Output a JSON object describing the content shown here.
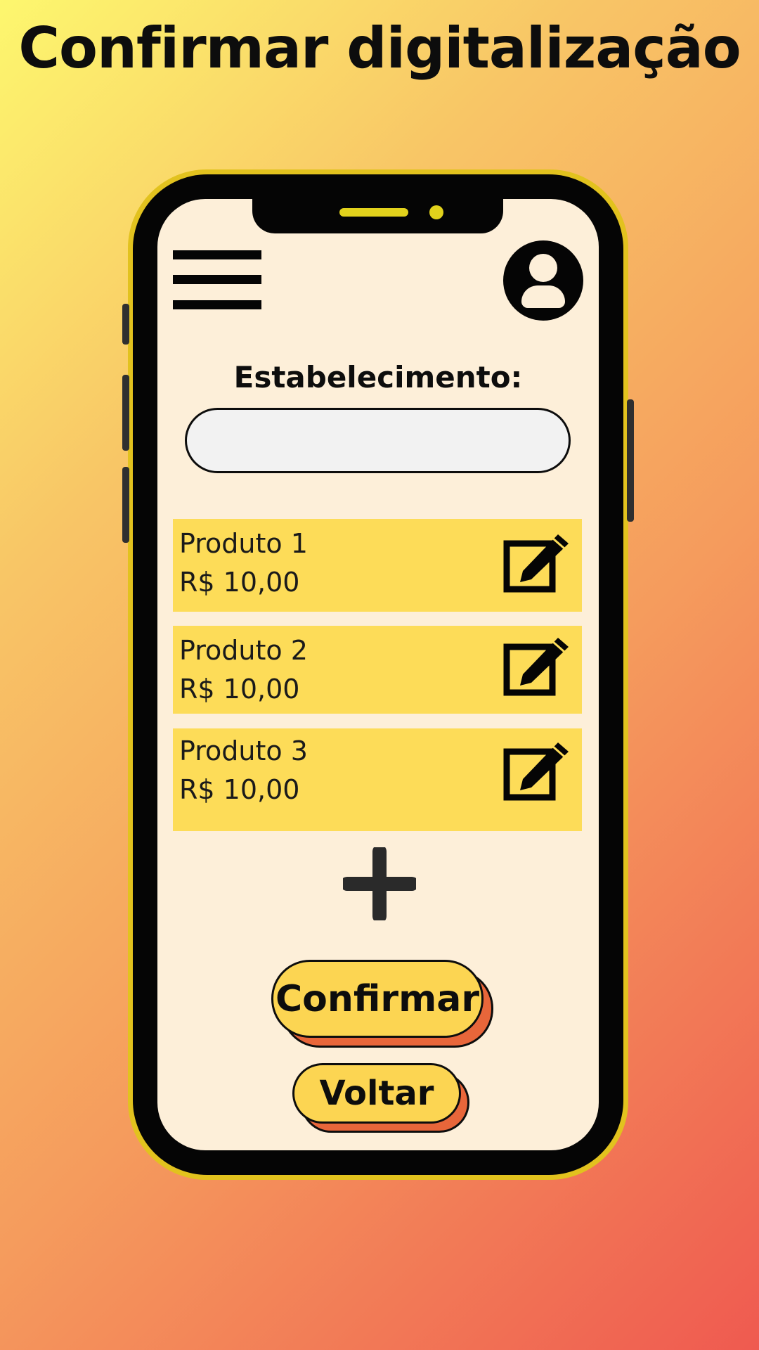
{
  "page": {
    "title": "Confirmar digitalização"
  },
  "form": {
    "label": "Estabelecimento:",
    "value": "",
    "placeholder": ""
  },
  "products": [
    {
      "name": "Produto 1",
      "price": "R$ 10,00",
      "icon": "edit-icon"
    },
    {
      "name": "Produto 2",
      "price": "R$ 10,00",
      "icon": "edit-icon"
    },
    {
      "name": "Produto 3",
      "price": "R$ 10,00",
      "icon": "edit-icon"
    }
  ],
  "actions": {
    "add_icon": "plus-icon",
    "confirm_label": "Confirmar",
    "back_label": "Voltar"
  },
  "icons": {
    "menu": "hamburger-menu-icon",
    "profile": "user-avatar-icon"
  },
  "colors": {
    "gradient": [
      "#fdf76e",
      "#f8c566",
      "#f59b5d",
      "#ef5a50"
    ],
    "phone_frame": "#e2c21e",
    "screen_bg": "#fdefd9",
    "product_bg": "#fddc58",
    "button_bg": "#fcd552",
    "button_shadow": "#e8663a",
    "input_bg": "#f2f2f2"
  }
}
